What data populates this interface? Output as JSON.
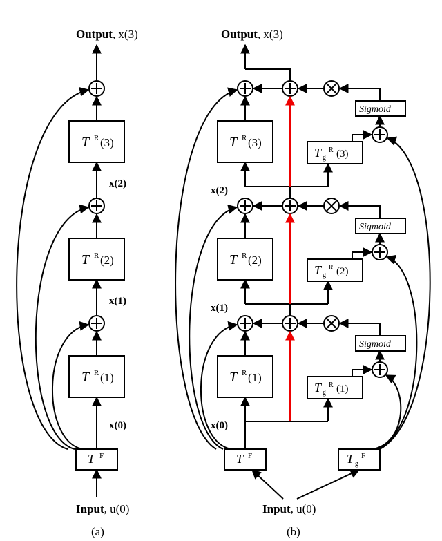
{
  "left": {
    "caption": "(a)",
    "input_label_a": "Input",
    "input_label_b": ", u(0)",
    "output_label_a": "Output",
    "output_label_b": ", x(3)",
    "tf": "T",
    "tf_sup": "F",
    "tr_sup": "R",
    "stages": [
      {
        "x": "x(0)",
        "idx": "(1)"
      },
      {
        "x": "x(1)",
        "idx": "(2)"
      },
      {
        "x": "x(2)",
        "idx": "(3)"
      }
    ]
  },
  "right": {
    "caption": "(b)",
    "input_label_a": "Input",
    "input_label_b": ", u(0)",
    "output_label_a": "Output",
    "output_label_b": ", x(3)",
    "sigmoid": "Sigmoid",
    "tf_label": "T",
    "tf_sup": "F",
    "tg_label": "T",
    "tg_sub": "g",
    "tg_supF": "F",
    "tg_supR": "R",
    "tr_sup": "R",
    "stages": [
      {
        "x": "x(0)",
        "idx": "(1)"
      },
      {
        "x": "x(1)",
        "idx": "(2)"
      },
      {
        "x": "x(2)",
        "idx": "(3)"
      }
    ]
  }
}
